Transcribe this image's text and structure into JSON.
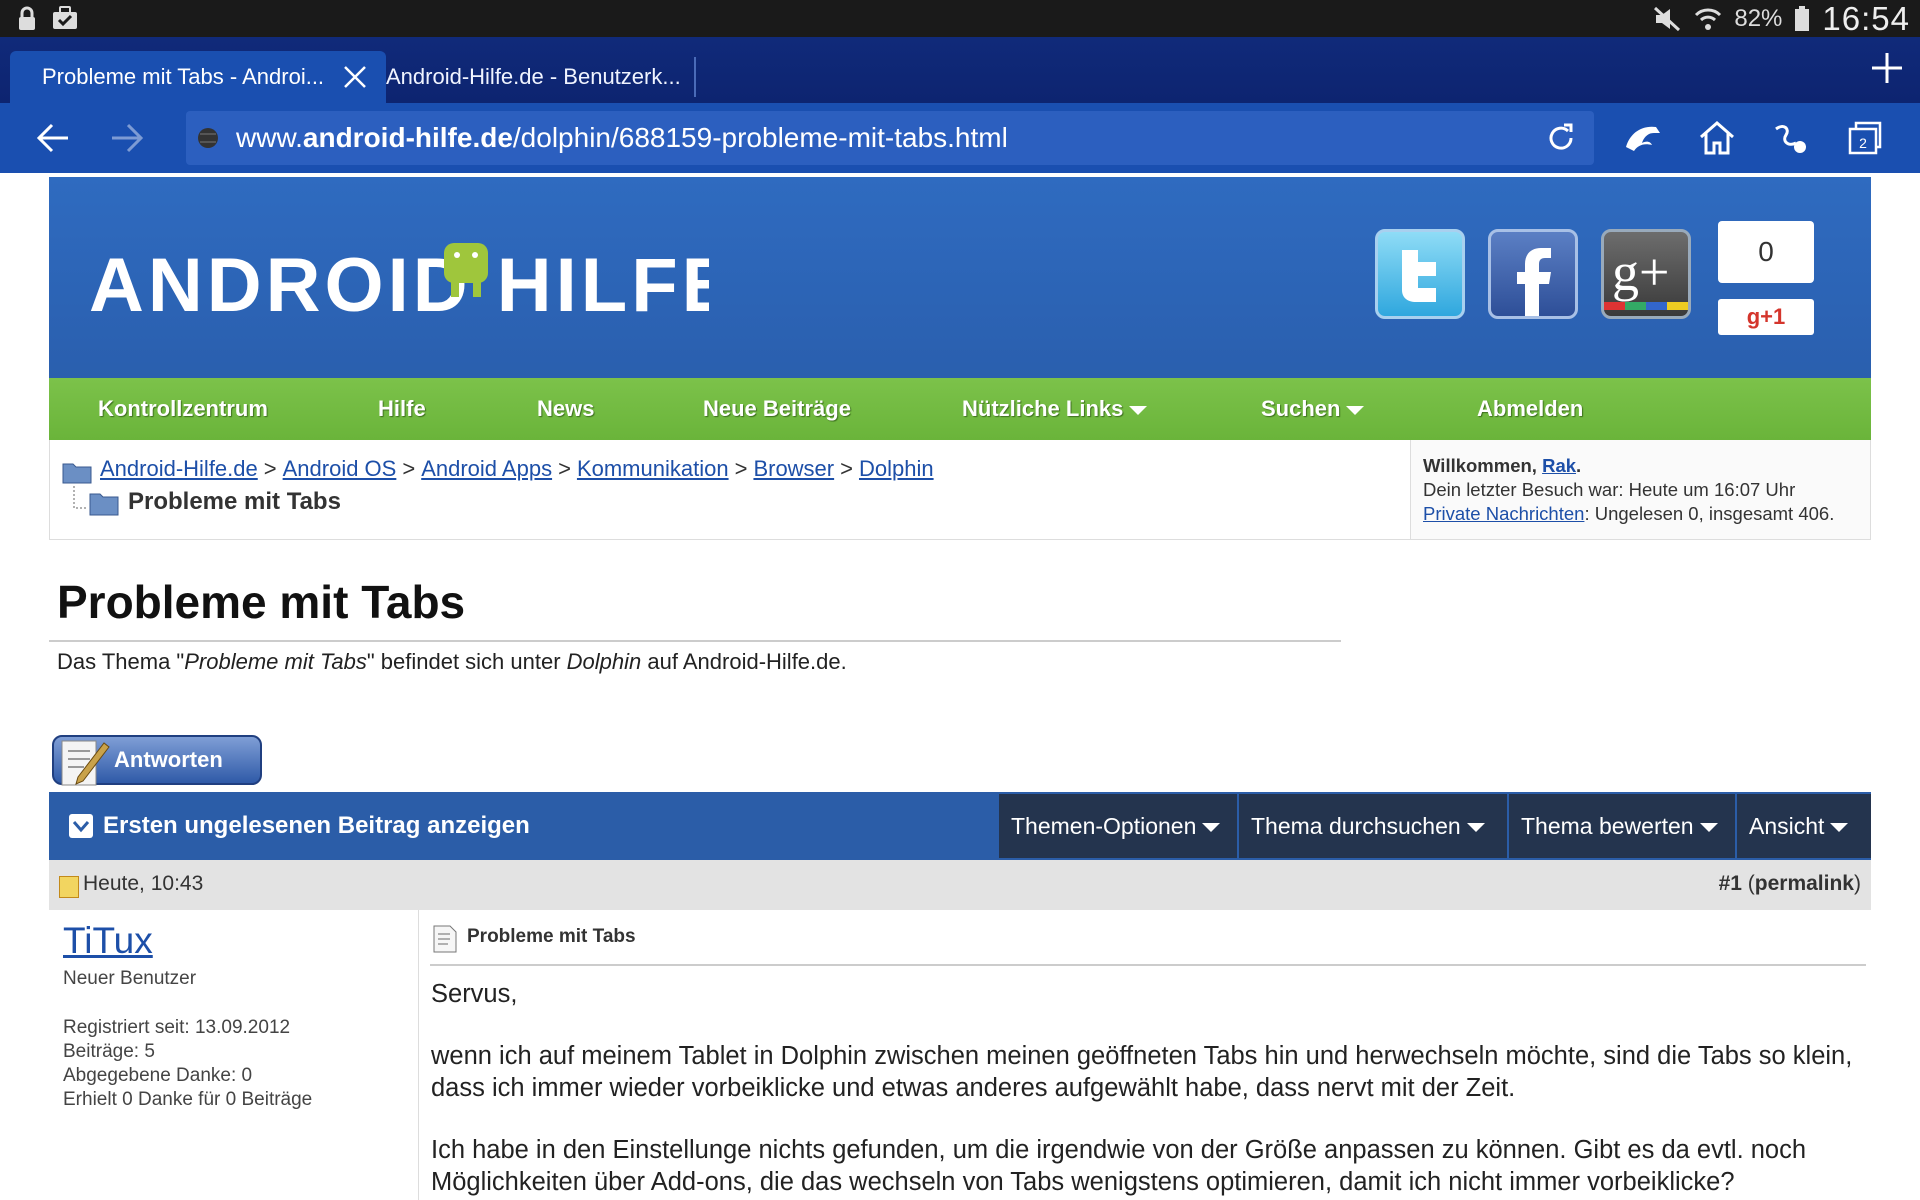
{
  "statusbar": {
    "battery_pct": "82%",
    "clock": "16:54"
  },
  "browser": {
    "tabs": [
      {
        "title": "Probleme mit Tabs - Androi..."
      },
      {
        "title": "Android-Hilfe.de - Benutzerk..."
      }
    ],
    "tab_count": "2",
    "url_prefix": "www.",
    "url_domain": "android-hilfe.de",
    "url_path": "/dolphin/688159-probleme-mit-tabs.html"
  },
  "header": {
    "logo_text": "ANDROID HILFE",
    "social": [
      "twitter-icon",
      "facebook-icon",
      "google-plus-icon"
    ],
    "plus_count": "0",
    "plus_label": "g+1"
  },
  "nav": {
    "items": [
      {
        "label": "Kontrollzentrum"
      },
      {
        "label": "Hilfe"
      },
      {
        "label": "News"
      },
      {
        "label": "Neue Beiträge"
      },
      {
        "label": "Nützliche Links"
      },
      {
        "label": "Suchen"
      },
      {
        "label": "Abmelden"
      }
    ]
  },
  "breadcrumb": {
    "items": [
      {
        "label": "Android-Hilfe.de"
      },
      {
        "label": "Android OS"
      },
      {
        "label": "Android Apps"
      },
      {
        "label": "Kommunikation"
      },
      {
        "label": "Browser"
      },
      {
        "label": "Dolphin"
      }
    ],
    "separator": ">",
    "current": "Probleme mit Tabs"
  },
  "welcome": {
    "greeting": "Willkommen,",
    "user": "Rak",
    "period": ".",
    "last_visit": "Dein letzter Besuch war: Heute um 16:07 Uhr",
    "pm_label": "Private Nachrichten",
    "pm_text": ": Ungelesen 0, insgesamt 406."
  },
  "thread": {
    "title": "Probleme mit Tabs",
    "desc_pre": "Das Thema \"",
    "desc_title": "Probleme mit Tabs",
    "desc_mid": "\" befindet sich unter ",
    "desc_forum": "Dolphin",
    "desc_post": " auf Android-Hilfe.de.",
    "reply_label": "Antworten"
  },
  "thread_toolbar": {
    "first_unread": "Ersten ungelesenen Beitrag anzeigen",
    "menus": [
      {
        "label": "Themen-Optionen"
      },
      {
        "label": "Thema durchsuchen"
      },
      {
        "label": "Thema bewerten"
      },
      {
        "label": "Ansicht"
      }
    ]
  },
  "post": {
    "date": "Heute, 10:43",
    "number": "#1",
    "permalink": "permalink",
    "author": "TiTux",
    "rank": "Neuer Benutzer",
    "stats": [
      "Registriert seit: 13.09.2012",
      "Beiträge: 5",
      "Abgegebene Danke: 0",
      "Erhielt 0 Danke für 0 Beiträge"
    ],
    "title": "Probleme mit Tabs",
    "paragraphs": [
      "Servus,",
      "wenn ich auf meinem Tablet in Dolphin zwischen meinen geöffneten Tabs hin und herwechseln möchte, sind die Tabs so klein, dass ich immer wieder vorbeiklicke und etwas anderes aufgewählt habe, dass nervt mit der Zeit.",
      "Ich habe in den Einstellunge nichts gefunden, um die irgendwie von der Größe anpassen zu können. Gibt es da evtl. noch Möglichkeiten über Add-ons, die das wechseln von Tabs wenigstens optimieren, damit ich nicht immer vorbeiklicke?"
    ]
  }
}
